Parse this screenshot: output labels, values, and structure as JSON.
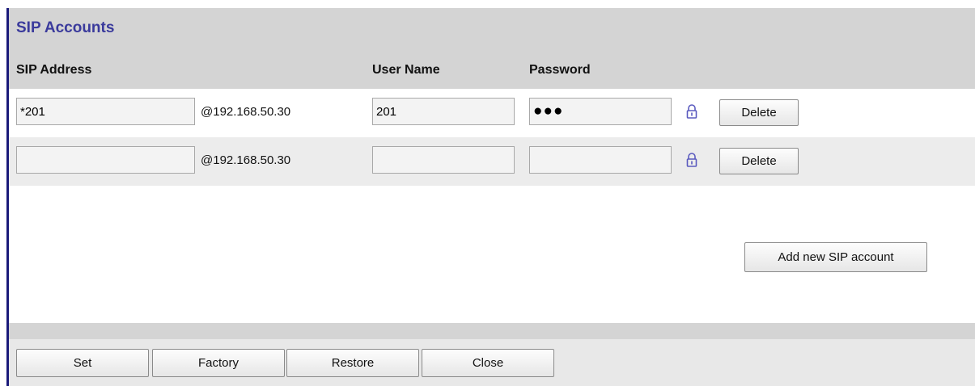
{
  "panel": {
    "title": "SIP Accounts"
  },
  "columns": {
    "sip_address": "SIP Address",
    "user_name": "User Name",
    "password": "Password"
  },
  "accounts": [
    {
      "sip_address": "*201",
      "domain": "@192.168.50.30",
      "user_name": "201",
      "password": "●●●",
      "lock_icon": "lock-icon",
      "delete_label": "Delete"
    },
    {
      "sip_address": "",
      "domain": "@192.168.50.30",
      "user_name": "",
      "password": "",
      "lock_icon": "lock-icon",
      "delete_label": "Delete"
    }
  ],
  "actions": {
    "add_label": "Add new SIP account"
  },
  "footer": {
    "set_label": "Set",
    "factory_label": "Factory",
    "restore_label": "Restore",
    "close_label": "Close"
  },
  "colors": {
    "title": "#3a3a9c",
    "accent_border": "#1a1a7a",
    "header_bg": "#d4d4d4",
    "alt_row_bg": "#ececec",
    "lock_icon": "#5b5bbf"
  }
}
